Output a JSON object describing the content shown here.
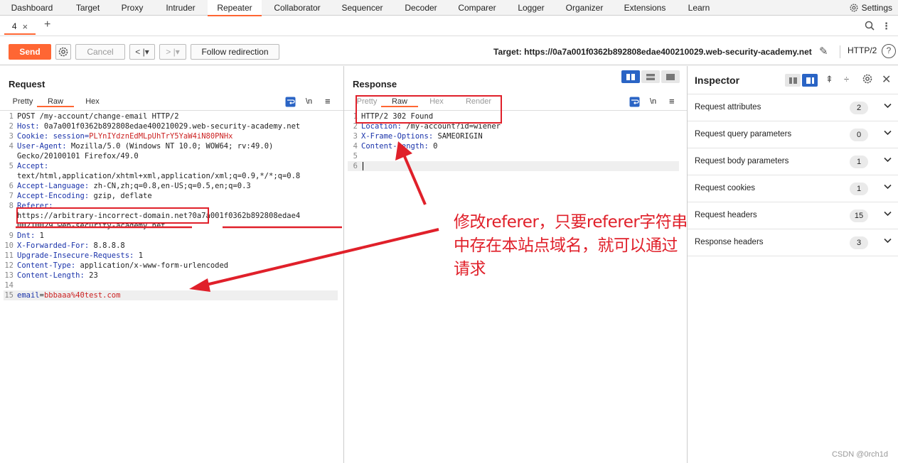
{
  "nav": {
    "tabs": [
      "Dashboard",
      "Target",
      "Proxy",
      "Intruder",
      "Repeater",
      "Collaborator",
      "Sequencer",
      "Decoder",
      "Comparer",
      "Logger",
      "Organizer",
      "Extensions",
      "Learn"
    ],
    "active": "Repeater",
    "settings_label": "Settings"
  },
  "repeater_tab": {
    "label": "4",
    "close": "×",
    "add": "+"
  },
  "toolbar": {
    "send": "Send",
    "cancel": "Cancel",
    "nav_back": "< |▾",
    "nav_fwd": "> |▾",
    "follow": "Follow redirection",
    "target": "Target: https://0a7a001f0362b892808edae400210029.web-security-academy.net",
    "protocol": "HTTP/2",
    "help": "?"
  },
  "request": {
    "title": "Request",
    "tabs": [
      "Pretty",
      "Raw",
      "Hex"
    ],
    "active_tab": "Raw",
    "newline_label": "\\n",
    "lines": [
      {
        "n": "1",
        "parts": [
          {
            "t": "POST /my-account/change-email HTTP/2",
            "c": ""
          }
        ]
      },
      {
        "n": "2",
        "parts": [
          {
            "t": "Host:",
            "c": "hk"
          },
          {
            "t": " 0a7a001f0362b892808edae400210029.web-security-academy.net",
            "c": ""
          }
        ]
      },
      {
        "n": "3",
        "parts": [
          {
            "t": "Cookie:",
            "c": "hk"
          },
          {
            "t": " session=",
            "c": "hk"
          },
          {
            "t": "PLYnIYdznEdMLpUhTrY5YaW4iN80PNHx",
            "c": "cookieval"
          }
        ]
      },
      {
        "n": "4",
        "parts": [
          {
            "t": "User-Agent:",
            "c": "hk"
          },
          {
            "t": " Mozilla/5.0 (Windows NT 10.0; WOW64; rv:49.0)",
            "c": ""
          }
        ]
      },
      {
        "n": "",
        "parts": [
          {
            "t": "Gecko/20100101 Firefox/49.0",
            "c": ""
          }
        ]
      },
      {
        "n": "5",
        "parts": [
          {
            "t": "Accept:",
            "c": "hk"
          }
        ]
      },
      {
        "n": "",
        "parts": [
          {
            "t": "text/html,application/xhtml+xml,application/xml;q=0.9,*/*;q=0.8",
            "c": ""
          }
        ]
      },
      {
        "n": "6",
        "parts": [
          {
            "t": "Accept-Language:",
            "c": "hk"
          },
          {
            "t": " zh-CN,zh;q=0.8,en-US;q=0.5,en;q=0.3",
            "c": ""
          }
        ]
      },
      {
        "n": "7",
        "parts": [
          {
            "t": "Accept-Encoding:",
            "c": "hk"
          },
          {
            "t": " gzip, deflate",
            "c": ""
          }
        ]
      },
      {
        "n": "8",
        "parts": [
          {
            "t": "Referer:",
            "c": "hk"
          }
        ]
      },
      {
        "n": "",
        "parts": [
          {
            "t": "https://arbitrary-incorrect-domain.net?0a7a001f0362b892808edae4",
            "c": ""
          }
        ]
      },
      {
        "n": "",
        "parts": [
          {
            "t": "00210029.web-security-academy.net",
            "c": ""
          }
        ]
      },
      {
        "n": "9",
        "parts": [
          {
            "t": "Dnt:",
            "c": "hk"
          },
          {
            "t": " 1",
            "c": ""
          }
        ]
      },
      {
        "n": "10",
        "parts": [
          {
            "t": "X-Forwarded-For:",
            "c": "hk"
          },
          {
            "t": " 8.8.8.8",
            "c": ""
          }
        ]
      },
      {
        "n": "11",
        "parts": [
          {
            "t": "Upgrade-Insecure-Requests:",
            "c": "hk"
          },
          {
            "t": " 1",
            "c": ""
          }
        ]
      },
      {
        "n": "12",
        "parts": [
          {
            "t": "Content-Type:",
            "c": "hk"
          },
          {
            "t": " application/x-www-form-urlencoded",
            "c": ""
          }
        ]
      },
      {
        "n": "13",
        "parts": [
          {
            "t": "Content-Length:",
            "c": "hk"
          },
          {
            "t": " 23",
            "c": ""
          }
        ]
      },
      {
        "n": "14",
        "parts": []
      },
      {
        "n": "15",
        "parts": [
          {
            "t": "email",
            "c": "bodykey"
          },
          {
            "t": "=",
            "c": ""
          },
          {
            "t": "bbbaaa%40test.com",
            "c": "bodyval"
          }
        ]
      }
    ]
  },
  "response": {
    "title": "Response",
    "tabs": [
      "Pretty",
      "Raw",
      "Hex",
      "Render"
    ],
    "active_tab": "Raw",
    "newline_label": "\\n",
    "lines": [
      {
        "n": "1",
        "parts": [
          {
            "t": "HTTP/2 302 Found",
            "c": ""
          }
        ]
      },
      {
        "n": "2",
        "parts": [
          {
            "t": "Location:",
            "c": "hk"
          },
          {
            "t": " /my-account?id=wiener",
            "c": ""
          }
        ]
      },
      {
        "n": "3",
        "parts": [
          {
            "t": "X-Frame-Options:",
            "c": "hk"
          },
          {
            "t": " SAMEORIGIN",
            "c": ""
          }
        ]
      },
      {
        "n": "4",
        "parts": [
          {
            "t": "Content-Length:",
            "c": "hk"
          },
          {
            "t": " 0",
            "c": ""
          }
        ]
      },
      {
        "n": "5",
        "parts": []
      },
      {
        "n": "6",
        "parts": []
      }
    ]
  },
  "inspector": {
    "title": "Inspector",
    "rows": [
      {
        "label": "Request attributes",
        "count": "2"
      },
      {
        "label": "Request query parameters",
        "count": "0"
      },
      {
        "label": "Request body parameters",
        "count": "1"
      },
      {
        "label": "Request cookies",
        "count": "1"
      },
      {
        "label": "Request headers",
        "count": "15"
      },
      {
        "label": "Response headers",
        "count": "3"
      }
    ]
  },
  "annotation": {
    "lines": [
      "修改referer，只要referer字符串",
      "中存在本站点域名，就可以通过",
      "请求"
    ],
    "color": "#e0202a"
  },
  "watermark": "CSDN @0rch1d",
  "colors": {
    "accent": "#ff6633",
    "header_key": "#1a33aa",
    "value_red": "#cc2222"
  }
}
